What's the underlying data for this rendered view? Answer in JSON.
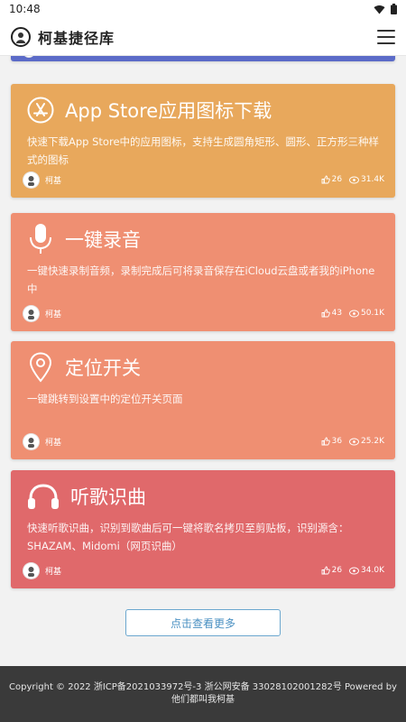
{
  "status_bar": {
    "time": "10:48"
  },
  "app": {
    "title": "柯基捷径库"
  },
  "partial_card": {
    "color": "#5b6bc8"
  },
  "cards": [
    {
      "title": "App Store应用图标下载",
      "description": "快速下载App Store中的应用图标，支持生成圆角矩形、圆形、正方形三种样式的图标",
      "author": "柯基",
      "likes": "26",
      "views": "31.4K",
      "color": "#e8a85c",
      "icon": "app-store-icon"
    },
    {
      "title": "一键录音",
      "description": "一键快速录制音频，录制完成后可将录音保存在iCloud云盘或者我的iPhone中",
      "author": "柯基",
      "likes": "43",
      "views": "50.1K",
      "color": "#ef8f72",
      "icon": "microphone-icon"
    },
    {
      "title": "定位开关",
      "description": "一键跳转到设置中的定位开关页面",
      "author": "柯基",
      "likes": "36",
      "views": "25.2K",
      "color": "#ef8f72",
      "icon": "location-pin-icon"
    },
    {
      "title": "听歌识曲",
      "description": "快速听歌识曲，识别到歌曲后可一键将歌名拷贝至剪贴板，识别源含：SHAZAM、Midomi（网页识曲）",
      "author": "柯基",
      "likes": "26",
      "views": "34.0K",
      "color": "#e0696b",
      "icon": "headphones-icon"
    }
  ],
  "load_more": {
    "label": "点击查看更多"
  },
  "footer": {
    "text": "Copyright © 2022 浙ICP备2021033972号-3 浙公网安备 33028102001282号 Powered by 他们都叫我柯基"
  }
}
